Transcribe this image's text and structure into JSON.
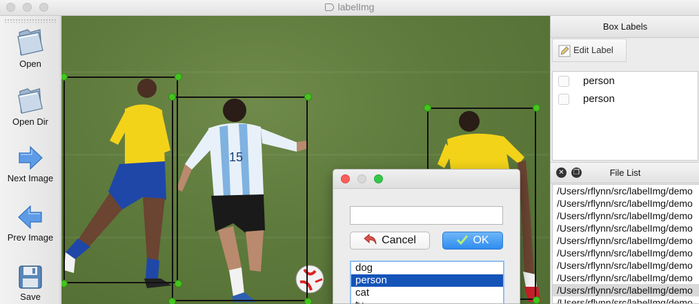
{
  "window": {
    "title": "labelImg"
  },
  "toolbar": {
    "open_label": "Open",
    "open_dir_label": "Open Dir",
    "next_image_label": "Next Image",
    "prev_image_label": "Prev Image",
    "save_label": "Save"
  },
  "dialog": {
    "input_value": "",
    "cancel_label": "Cancel",
    "ok_label": "OK",
    "options": [
      "dog",
      "person",
      "cat",
      "tv"
    ],
    "selected": "person"
  },
  "box_labels": {
    "header": "Box Labels",
    "edit_label_button": "Edit Label",
    "items": [
      {
        "label": "person",
        "checked": false
      },
      {
        "label": "person",
        "checked": false
      }
    ]
  },
  "file_list": {
    "header": "File List",
    "files": [
      "/Users/rflynn/src/labelImg/demo",
      "/Users/rflynn/src/labelImg/demo",
      "/Users/rflynn/src/labelImg/demo",
      "/Users/rflynn/src/labelImg/demo",
      "/Users/rflynn/src/labelImg/demo",
      "/Users/rflynn/src/labelImg/demo",
      "/Users/rflynn/src/labelImg/demo",
      "/Users/rflynn/src/labelImg/demo",
      "/Users/rflynn/src/labelImg/demo",
      "/Users/rflynn/src/labelImg/demo"
    ],
    "selected_index": 8
  },
  "colors": {
    "handle": "#43c41f",
    "box_stroke": "#111111",
    "selection": "#1454b8",
    "ok_button": "#2e8cf0"
  },
  "icons": {
    "open": "folder-icon",
    "open_dir": "folder-icon",
    "next": "arrow-right-icon",
    "prev": "arrow-left-icon",
    "save": "floppy-disk-icon",
    "edit": "pencil-icon",
    "cancel": "undo-arrow-icon",
    "ok": "checkmark-icon"
  }
}
